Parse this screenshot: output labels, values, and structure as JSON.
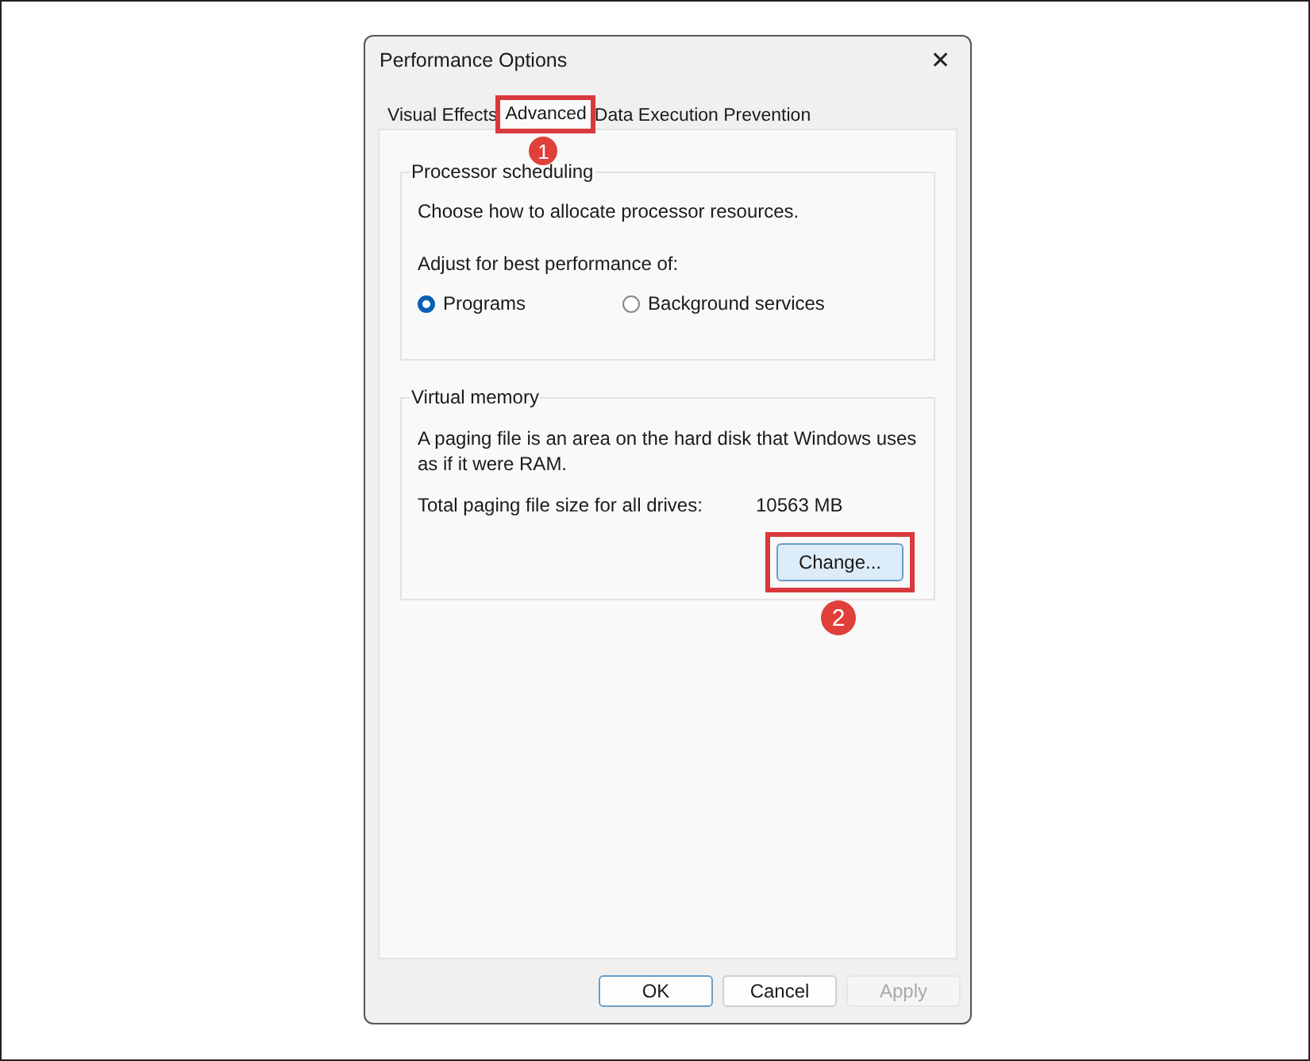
{
  "window": {
    "title": "Performance Options",
    "close": "✕"
  },
  "tabs": [
    {
      "label": "Visual Effects",
      "selected": false,
      "highlighted": false
    },
    {
      "label": "Advanced",
      "selected": true,
      "highlighted": true,
      "marker": "1"
    },
    {
      "label": "Data Execution Prevention",
      "selected": false,
      "highlighted": false
    }
  ],
  "processor_scheduling": {
    "title": "Processor scheduling",
    "description": "Choose how to allocate processor resources.",
    "prompt": "Adjust for best performance of:",
    "options": [
      {
        "label": "Programs",
        "selected": true
      },
      {
        "label": "Background services",
        "selected": false
      }
    ]
  },
  "virtual_memory": {
    "title": "Virtual memory",
    "description": "A paging file is an area on the hard disk that Windows uses as if it were RAM.",
    "size_label": "Total paging file size for all drives:",
    "size_value": "10563 MB",
    "button": {
      "label": "Change...",
      "highlighted": true,
      "marker": "2"
    }
  },
  "buttons": [
    {
      "label": "OK",
      "disabled": false,
      "default": true
    },
    {
      "label": "Cancel",
      "disabled": false,
      "default": false
    },
    {
      "label": "Apply",
      "disabled": true,
      "default": false
    }
  ]
}
